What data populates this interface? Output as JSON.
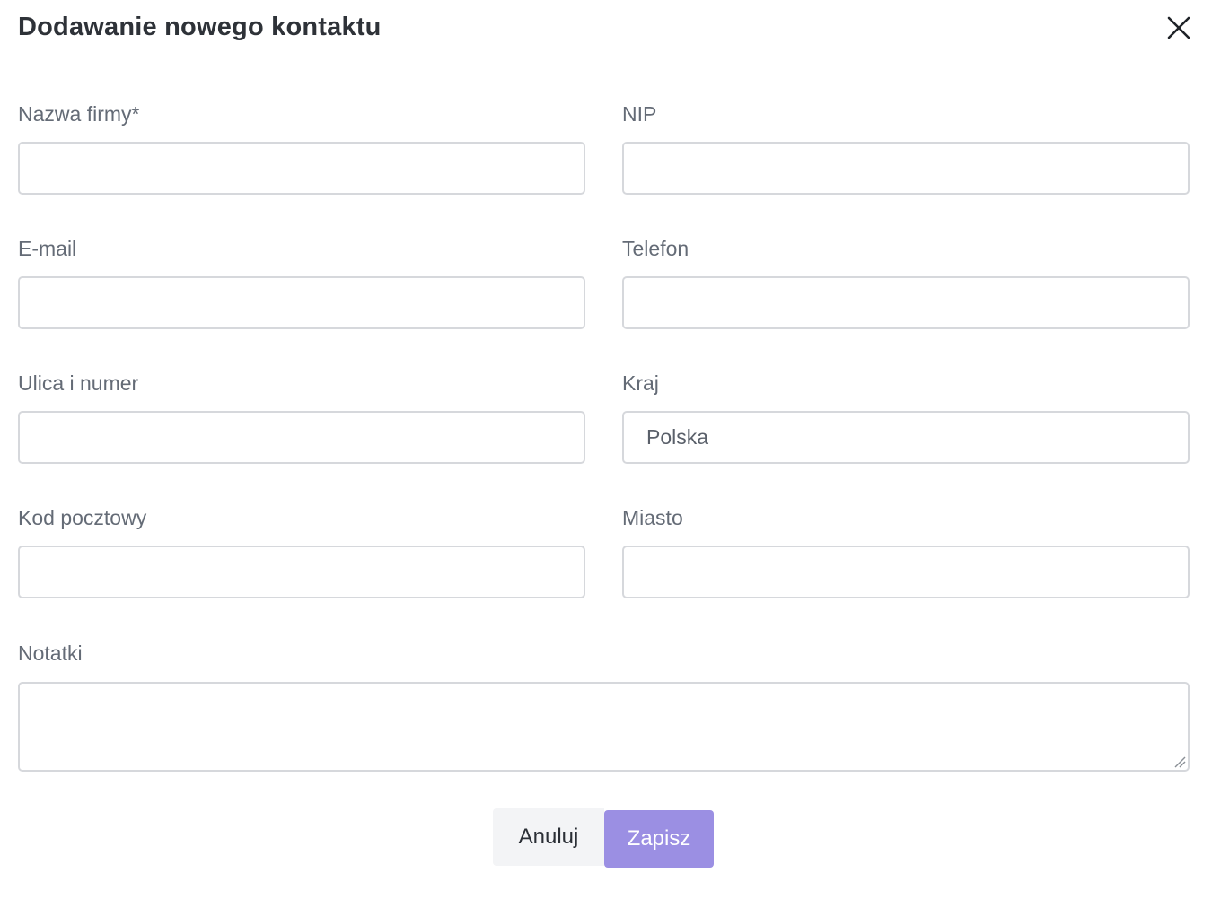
{
  "dialog": {
    "title": "Dodawanie nowego kontaktu",
    "close_icon": "close-icon"
  },
  "form": {
    "company_name": {
      "label": "Nazwa firmy*",
      "value": "",
      "placeholder": ""
    },
    "nip": {
      "label": "NIP",
      "value": "",
      "placeholder": ""
    },
    "email": {
      "label": "E-mail",
      "value": "",
      "placeholder": ""
    },
    "phone": {
      "label": "Telefon",
      "value": "",
      "placeholder": ""
    },
    "street": {
      "label": "Ulica i numer",
      "value": "",
      "placeholder": ""
    },
    "country": {
      "label": "Kraj",
      "value": "Polska",
      "placeholder": ""
    },
    "postal_code": {
      "label": "Kod pocztowy",
      "value": "",
      "placeholder": ""
    },
    "city": {
      "label": "Miasto",
      "value": "",
      "placeholder": ""
    },
    "notes": {
      "label": "Notatki",
      "value": "",
      "placeholder": ""
    }
  },
  "actions": {
    "cancel_label": "Anuluj",
    "save_label": "Zapisz"
  },
  "colors": {
    "primary": "#9b8fe3",
    "cancel_bg": "#f3f4f6",
    "border": "#d6d8dc",
    "label": "#646b76"
  }
}
